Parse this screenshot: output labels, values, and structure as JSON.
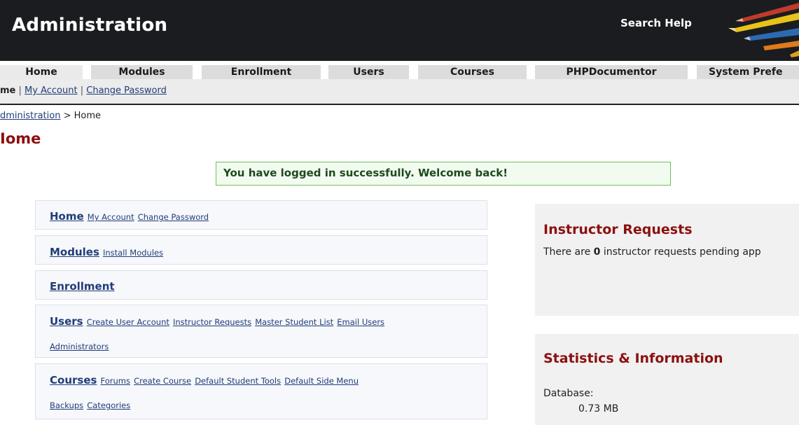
{
  "header": {
    "title": "Administration",
    "search_help": "Search Help"
  },
  "tabs": [
    {
      "label": "Home"
    },
    {
      "label": "Modules"
    },
    {
      "label": "Enrollment"
    },
    {
      "label": "Users"
    },
    {
      "label": "Courses"
    },
    {
      "label": "PHPDocumentor"
    },
    {
      "label": "System Prefe"
    }
  ],
  "subnav": {
    "current": "me",
    "sep1": "|",
    "my_account": "My Account",
    "sep2": "|",
    "change_password": "Change Password"
  },
  "breadcrumb": {
    "link": "dministration",
    "separator": ">",
    "current": "Home"
  },
  "page_title": "Iome",
  "alert": "You have logged in successfully. Welcome back!",
  "nav_boxes": {
    "home": {
      "title": "Home",
      "links": [
        "My Account",
        "Change Password"
      ]
    },
    "modules": {
      "title": "Modules",
      "links": [
        "Install Modules"
      ]
    },
    "enrollment": {
      "title": "Enrollment"
    },
    "users": {
      "title": "Users",
      "links": [
        "Create User Account",
        "Instructor Requests",
        "Master Student List",
        "Email Users",
        "Administrators"
      ]
    },
    "courses": {
      "title": "Courses",
      "links": [
        "Forums",
        "Create Course",
        "Default Student Tools",
        "Default Side Menu",
        "Backups",
        "Categories"
      ]
    }
  },
  "instructor_requests": {
    "heading": "Instructor Requests",
    "text_before": "There are",
    "count": "0",
    "text_after": "instructor requests pending app"
  },
  "statistics": {
    "heading": "Statistics & Information",
    "database_label": "Database:",
    "database_size": "0.73 MB"
  },
  "colors": {
    "header_bg": "#1a1c1f",
    "accent_red": "#8c1010",
    "link_blue": "#1f3d7a",
    "success_border": "#6cc05a"
  }
}
